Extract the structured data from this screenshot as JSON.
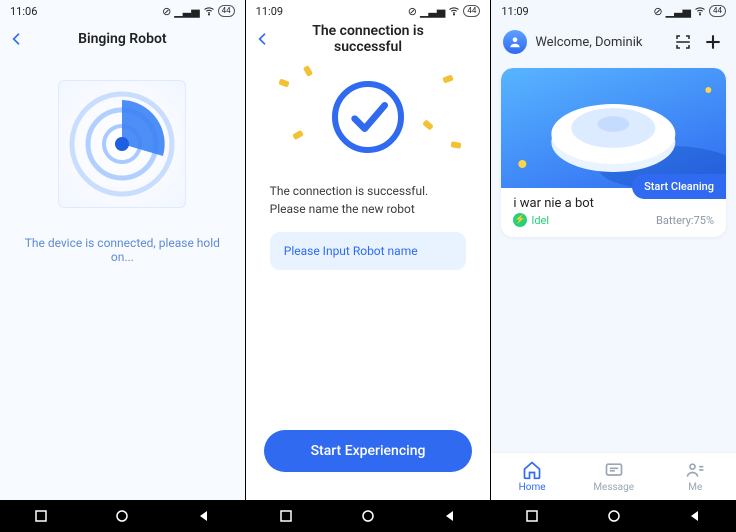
{
  "screen1": {
    "time": "11:06",
    "battery_label": "44",
    "title": "Binging Robot",
    "status_text": "The device is connected, please hold on..."
  },
  "screen2": {
    "time": "11:09",
    "battery_label": "44",
    "title": "The connection is successful",
    "success_text": "The connection is successful. Please name the new robot",
    "input_placeholder": "Please Input Robot name",
    "button_label": "Start Experiencing"
  },
  "screen3": {
    "time": "11:09",
    "battery_label": "44",
    "welcome": "Welcome, Dominik",
    "robot_name": "i war nie a bot",
    "status_label": "Idel",
    "battery_text": "Battery:75%",
    "start_cleaning": "Start Cleaning",
    "tabs": {
      "home": "Home",
      "message": "Message",
      "me": "Me"
    }
  }
}
